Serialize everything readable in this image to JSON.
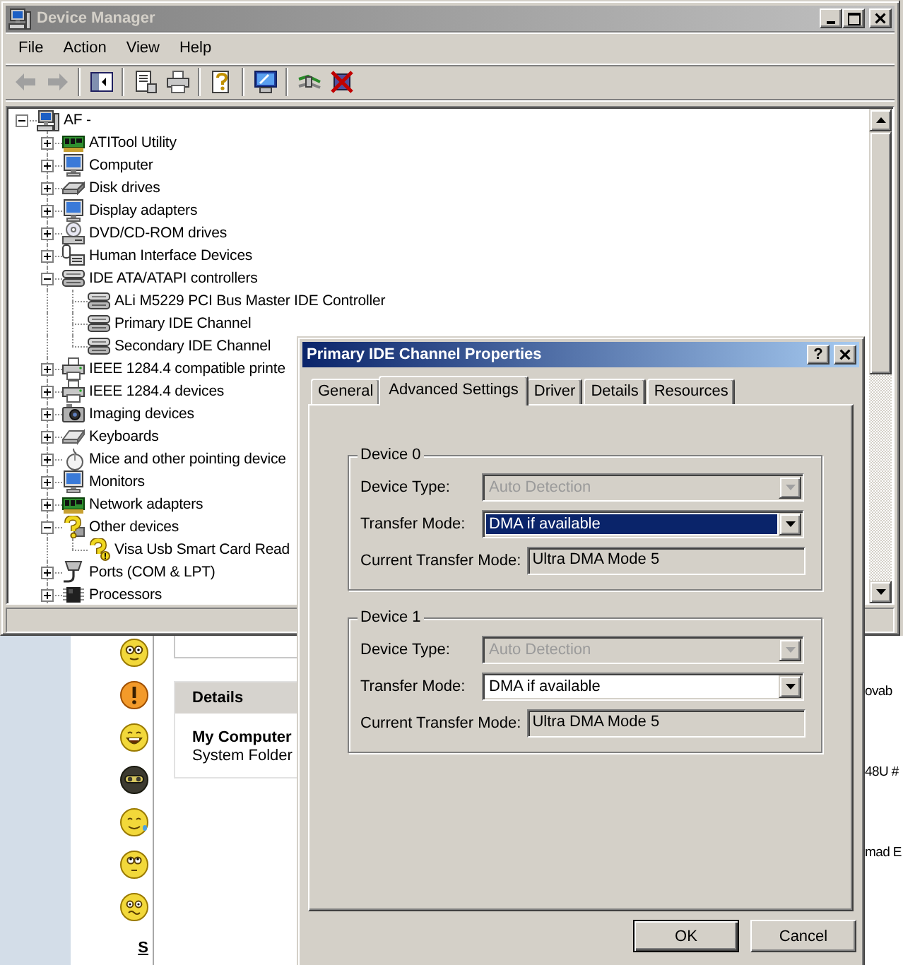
{
  "device_manager": {
    "title": "Device Manager",
    "active": false,
    "menu": [
      "File",
      "Action",
      "View",
      "Help"
    ],
    "toolbar_groups": [
      [
        {
          "disabled": true
        },
        {
          "disabled": true
        }
      ],
      [
        {
          "disabled": false
        }
      ],
      [
        {
          "disabled": false
        },
        {
          "disabled": false
        }
      ],
      [
        {
          "disabled": false
        }
      ],
      [
        {
          "disabled": false
        }
      ],
      [
        {
          "disabled": false
        },
        {
          "disabled": false
        }
      ]
    ],
    "tree": {
      "label": "AF -",
      "expanded": true,
      "children": [
        {
          "label": "ATITool Utility",
          "expanded": false
        },
        {
          "label": "Computer",
          "expanded": false
        },
        {
          "label": "Disk drives",
          "expanded": false
        },
        {
          "label": "Display adapters",
          "expanded": false
        },
        {
          "label": "DVD/CD-ROM drives",
          "expanded": false
        },
        {
          "label": "Human Interface Devices",
          "expanded": false
        },
        {
          "label": "IDE ATA/ATAPI controllers",
          "expanded": true,
          "children": [
            {
              "label": "ALi M5229 PCI Bus Master IDE Controller"
            },
            {
              "label": "Primary IDE Channel"
            },
            {
              "label": "Secondary IDE Channel"
            }
          ]
        },
        {
          "label": "IEEE 1284.4 compatible printe",
          "expanded": false
        },
        {
          "label": "IEEE 1284.4 devices",
          "expanded": false
        },
        {
          "label": "Imaging devices",
          "expanded": false
        },
        {
          "label": "Keyboards",
          "expanded": false
        },
        {
          "label": "Mice and other pointing device",
          "expanded": false
        },
        {
          "label": "Monitors",
          "expanded": false
        },
        {
          "label": "Network adapters",
          "expanded": false
        },
        {
          "label": "Other devices",
          "expanded": true,
          "children": [
            {
              "label": "Visa Usb Smart Card Read"
            }
          ]
        },
        {
          "label": "Ports (COM & LPT)",
          "expanded": false
        },
        {
          "label": "Processors",
          "expanded": false
        }
      ]
    }
  },
  "properties_dialog": {
    "title": "Primary IDE Channel Properties",
    "active": true,
    "help_button": "?",
    "tabs": [
      {
        "label": "General",
        "selected": false
      },
      {
        "label": "Advanced Settings",
        "selected": true
      },
      {
        "label": "Driver",
        "selected": false
      },
      {
        "label": "Details",
        "selected": false
      },
      {
        "label": "Resources",
        "selected": false
      }
    ],
    "groups": [
      {
        "title": "Device 0",
        "fields": [
          {
            "kind": "dropdown",
            "label": "Device Type:",
            "value": "Auto Detection",
            "disabled": true,
            "focused": false
          },
          {
            "kind": "dropdown",
            "label": "Transfer Mode:",
            "value": "DMA if available",
            "disabled": false,
            "focused": true
          },
          {
            "kind": "text",
            "label": "Current Transfer Mode:",
            "value": "Ultra DMA Mode 5"
          }
        ]
      },
      {
        "title": "Device 1",
        "fields": [
          {
            "kind": "dropdown",
            "label": "Device Type:",
            "value": "Auto Detection",
            "disabled": true,
            "focused": false
          },
          {
            "kind": "dropdown",
            "label": "Transfer Mode:",
            "value": "DMA if available",
            "disabled": false,
            "focused": false
          },
          {
            "kind": "text",
            "label": "Current Transfer Mode:",
            "value": "Ultra DMA Mode 5"
          }
        ]
      }
    ],
    "buttons": [
      {
        "label": "OK",
        "default": true
      },
      {
        "label": "Cancel",
        "default": false
      }
    ]
  },
  "background_window": {
    "details_panel": {
      "title": "Details",
      "name": "My Computer",
      "description": "System Folder"
    },
    "link": "S",
    "list_texts": [
      "ovab",
      "48U #",
      "mad E"
    ]
  }
}
